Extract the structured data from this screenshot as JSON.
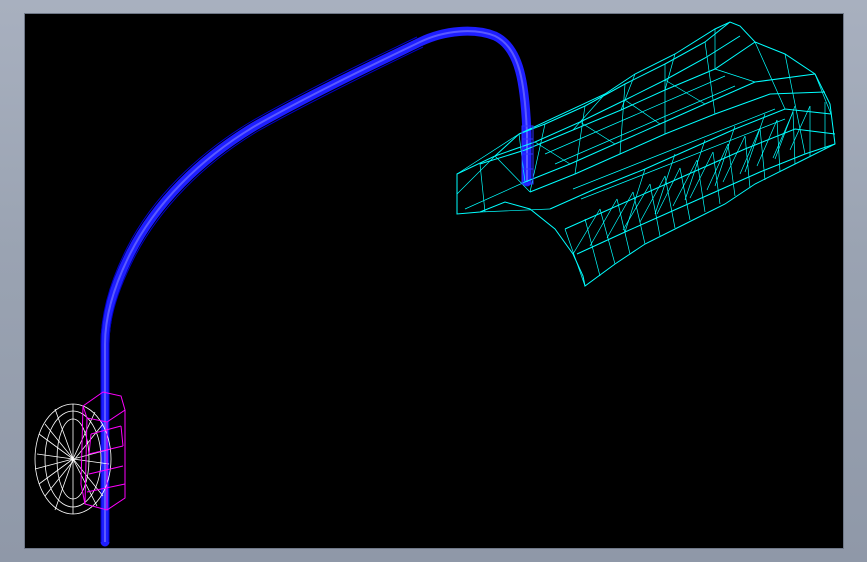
{
  "app": {
    "frame_color": "#9aa3b2",
    "viewport_background": "#000000"
  },
  "model": {
    "display_mode": "wireframe",
    "parts": [
      {
        "name": "lamp-head-housing",
        "color": "#00ffff",
        "icon": "wireframe-lamp-head-icon"
      },
      {
        "name": "curved-pole",
        "color": "#1e1eff",
        "icon": "wireframe-pole-icon"
      },
      {
        "name": "mount-bracket",
        "color": "#ff00ff",
        "icon": "wireframe-bracket-icon"
      },
      {
        "name": "base-cap",
        "color": "#ffffff",
        "icon": "wireframe-cap-icon"
      }
    ]
  }
}
